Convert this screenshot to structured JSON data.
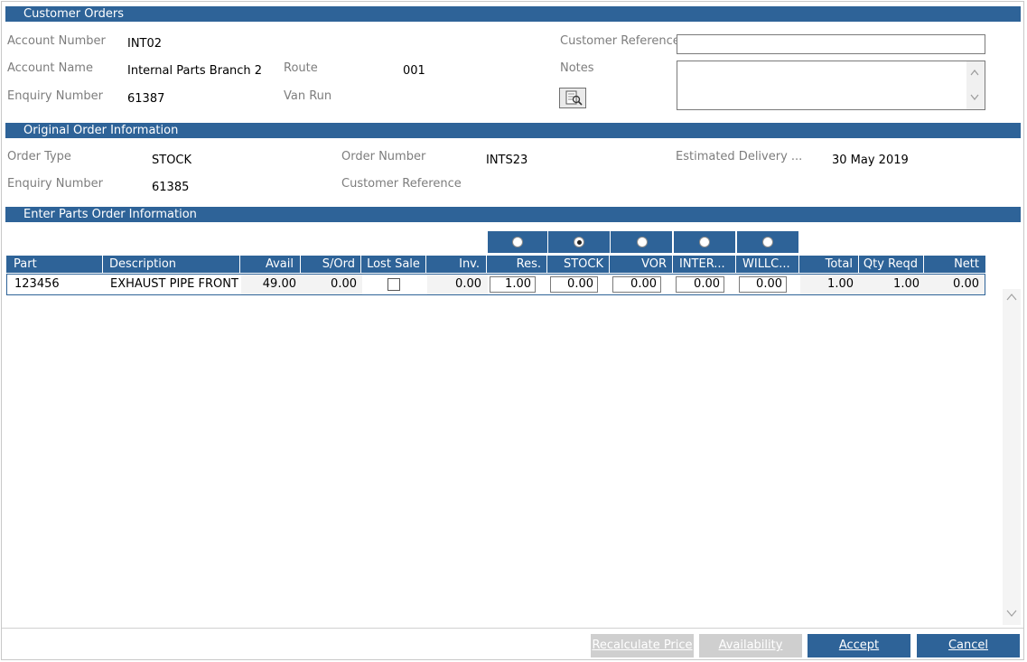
{
  "customer_orders": {
    "title": "Customer Orders",
    "account_number_label": "Account Number",
    "account_number": "INT02",
    "account_name_label": "Account Name",
    "account_name": "Internal Parts Branch 2",
    "route_label": "Route",
    "route": "001",
    "enquiry_number_label": "Enquiry Number",
    "enquiry_number": "61387",
    "van_run_label": "Van Run",
    "customer_reference_label": "Customer Reference",
    "customer_reference_value": "",
    "notes_label": "Notes",
    "notes_value": "",
    "notes_button_icon": "notes-lookup-icon"
  },
  "original_order": {
    "title": "Original Order Information",
    "order_type_label": "Order Type",
    "order_type": "STOCK",
    "order_number_label": "Order Number",
    "order_number": "INTS23",
    "estimated_delivery_label": "Estimated Delivery ...",
    "estimated_delivery": "30 May 2019",
    "enquiry_number_label": "Enquiry Number",
    "enquiry_number": "61385",
    "customer_reference_label": "Customer Reference"
  },
  "parts_order": {
    "title": "Enter Parts Order Information",
    "order_type_selected": "STOCK",
    "columns": [
      "Part",
      "Description",
      "Avail",
      "S/Ord",
      "Lost Sale",
      "Inv.",
      "Res.",
      "STOCK",
      "VOR",
      "INTER...",
      "WILLC...",
      "Total",
      "Qty Reqd",
      "Nett"
    ],
    "rows": [
      {
        "part": "123456",
        "description": "EXHAUST PIPE FRONT",
        "avail": "49.00",
        "s_ord": "0.00",
        "lost_sale": false,
        "inv": "0.00",
        "res": "1.00",
        "stock": "0.00",
        "vor": "0.00",
        "inter": "0.00",
        "willc": "0.00",
        "total": "1.00",
        "qty_reqd": "1.00",
        "nett": "0.00"
      }
    ]
  },
  "buttons": {
    "recalculate": "Recalculate Price",
    "availability": "Availability",
    "accept": "Accept",
    "cancel": "Cancel"
  }
}
